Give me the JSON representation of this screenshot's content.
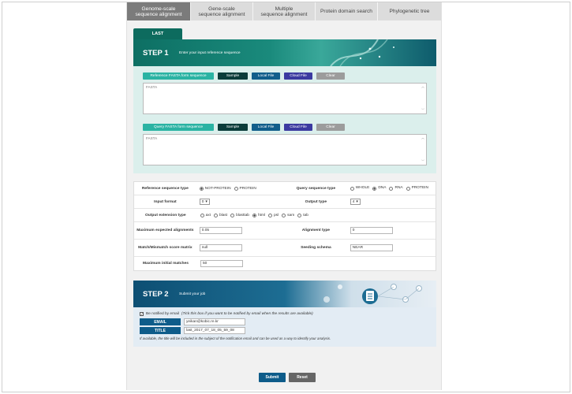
{
  "tabs": [
    {
      "label_line1": "Genome-scale",
      "label_line2": "sequence alignment"
    },
    {
      "label_line1": "Gene-scale",
      "label_line2": "sequence alignment"
    },
    {
      "label_line1": "Multiple",
      "label_line2": "sequence alignment"
    },
    {
      "label_line1": "Protein domain search",
      "label_line2": ""
    },
    {
      "label_line1": "Phylogenetic tree",
      "label_line2": ""
    }
  ],
  "last_tab": "LAST",
  "step1": {
    "title": "STEP 1",
    "subtitle": "Enter your input reference sequence",
    "reference": {
      "label": "Reference FASTA form sequence",
      "sample": "Sample",
      "local": "Local File",
      "cloud": "Cloud File",
      "clear": "Clear",
      "value": "FASTA"
    },
    "query": {
      "label": "Query FASTA form sequence",
      "sample": "Sample",
      "local": "Local File",
      "cloud": "Cloud File",
      "clear": "Clear",
      "value": "FASTA"
    }
  },
  "options": {
    "ref_type_label": "Reference sequence type",
    "ref_type_not_protein": "NOT-PROTEIN",
    "ref_type_protein": "PROTEIN",
    "query_type_label": "Query sequence type",
    "query_type_whole": "WHOLE",
    "query_type_dna": "DNA",
    "query_type_rna": "RNA",
    "query_type_protein": "PROTEIN",
    "input_format_label": "Input format",
    "input_format_value": "0",
    "output_type_label": "Output type",
    "output_type_value": "4",
    "output_ext_label": "Output extension type",
    "output_ext": [
      {
        "label": "axt",
        "checked": false
      },
      {
        "label": "blast",
        "checked": false
      },
      {
        "label": "blasttab",
        "checked": false
      },
      {
        "label": "html",
        "checked": true
      },
      {
        "label": "psl",
        "checked": false
      },
      {
        "label": "sam",
        "checked": false
      },
      {
        "label": "tab",
        "checked": false
      }
    ],
    "max_expected_label": "Maximum expected alignments",
    "max_expected_value": "0.05",
    "alignment_type_label": "Alignment type",
    "alignment_type_value": "0",
    "match_matrix_label": "Match/Mismatch score matrix",
    "match_matrix_value": "null",
    "seeding_label": "Seeding schema",
    "seeding_value": "NEAR",
    "max_initial_label": "Maximum initial matches",
    "max_initial_value": "50"
  },
  "step2": {
    "title": "STEP 2",
    "subtitle": "Submit your job",
    "notify_label": "Be notified by email",
    "notify_hint": "(Tick this box if you want to be notified by email when the results are available)",
    "email_label": "EMAIL",
    "email_value": "yeikan@kobic.re.kr",
    "title_label": "TITLE",
    "title_value": "last_2017_07_18_05_59_08",
    "note": "If available, the title will be included in the subject of the notification email and can be used as a way to identify your analysis."
  },
  "actions": {
    "submit": "Submit",
    "reset": "Reset"
  },
  "colors": {
    "teal": "#0d6b5e",
    "blue": "#0e5c8a",
    "aqua": "#2ab3a3"
  }
}
